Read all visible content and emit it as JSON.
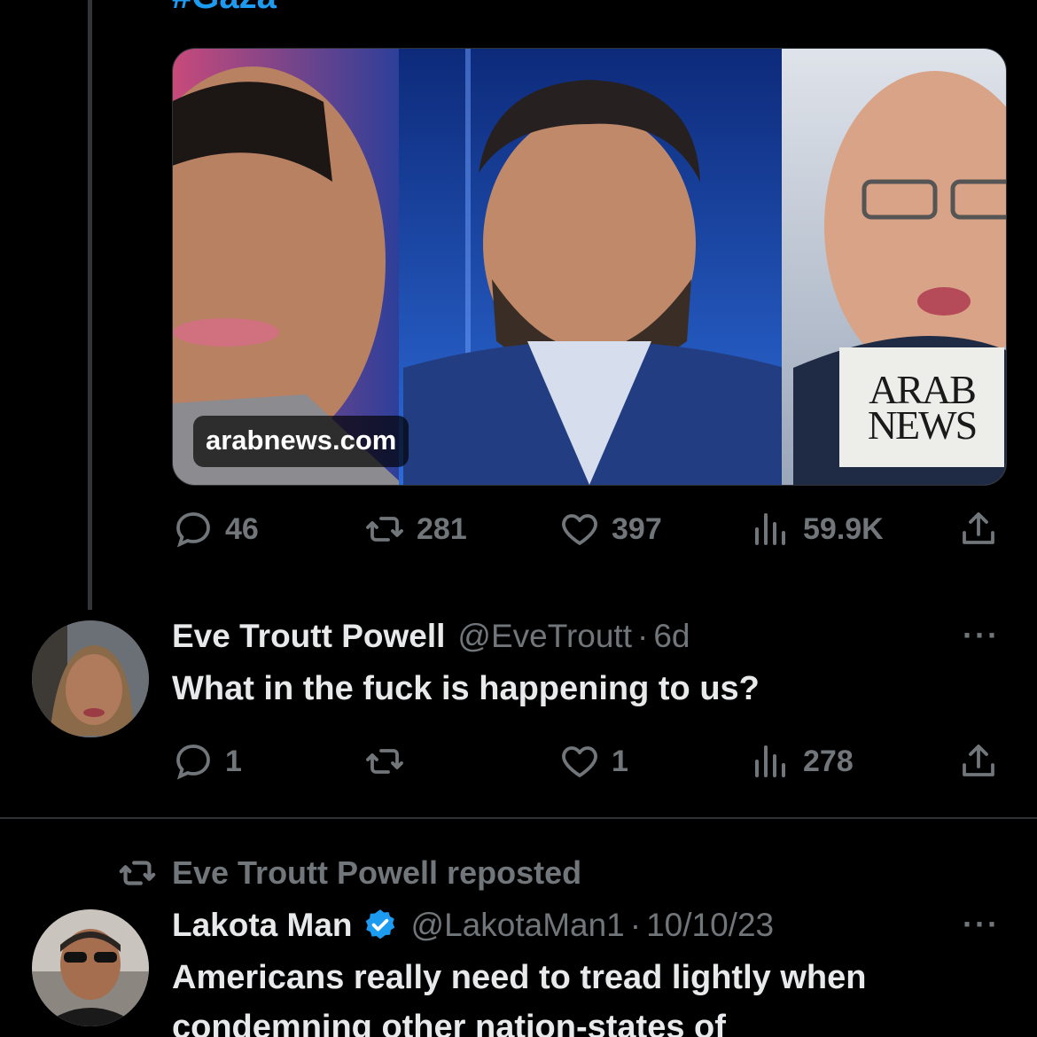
{
  "top_tweet": {
    "hashtag": "#Gaza",
    "link_domain": "arabnews.com",
    "logo_line1": "ARAB",
    "logo_line2": "NEWS",
    "replies": "46",
    "reposts": "281",
    "likes": "397",
    "views": "59.9K"
  },
  "reply_tweet": {
    "name": "Eve Troutt Powell",
    "handle": "@EveTroutt",
    "dot": "·",
    "time": "6d",
    "more": "···",
    "text": "What in the fuck is happening to us?",
    "replies": "1",
    "reposts": "",
    "likes": "1",
    "views": "278"
  },
  "repost_header": {
    "text": "Eve Troutt Powell reposted"
  },
  "lakota_tweet": {
    "name": "Lakota Man",
    "handle": "@LakotaMan1",
    "dot": "·",
    "time": "10/10/23",
    "more": "···",
    "text_line1": "Americans really need to tread lightly when",
    "text_line2": "condemning other nation-states of"
  },
  "colors": {
    "background": "#000000",
    "text": "#e7e9ea",
    "muted": "#71767b",
    "accent": "#1d9bf0",
    "divider": "#2f3336"
  }
}
